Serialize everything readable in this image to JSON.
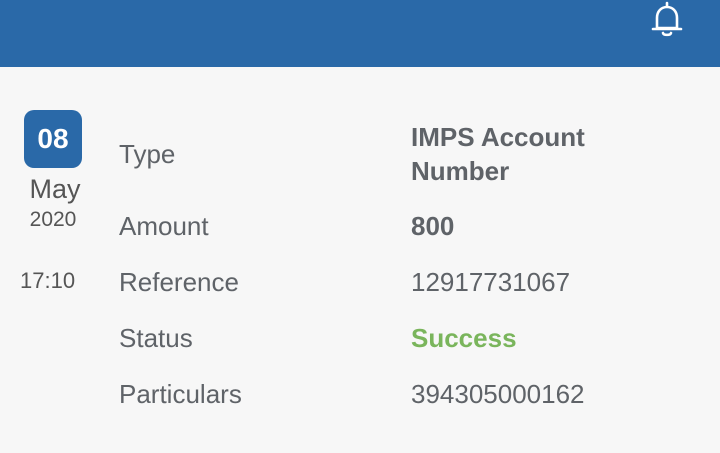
{
  "header": {
    "bg_color": "#2a69a8",
    "notification_icon": "bell-icon"
  },
  "transaction": {
    "date": {
      "day": "08",
      "month": "May",
      "year": "2020",
      "time": "17:10"
    },
    "rows": [
      {
        "label": "Type",
        "value": "IMPS Account Number"
      },
      {
        "label": "Amount",
        "value": "800"
      },
      {
        "label": "Reference",
        "value": "12917731067"
      },
      {
        "label": "Status",
        "value": "Success"
      },
      {
        "label": "Particulars",
        "value": "394305000162"
      }
    ],
    "status_color": "#7ab55c"
  }
}
